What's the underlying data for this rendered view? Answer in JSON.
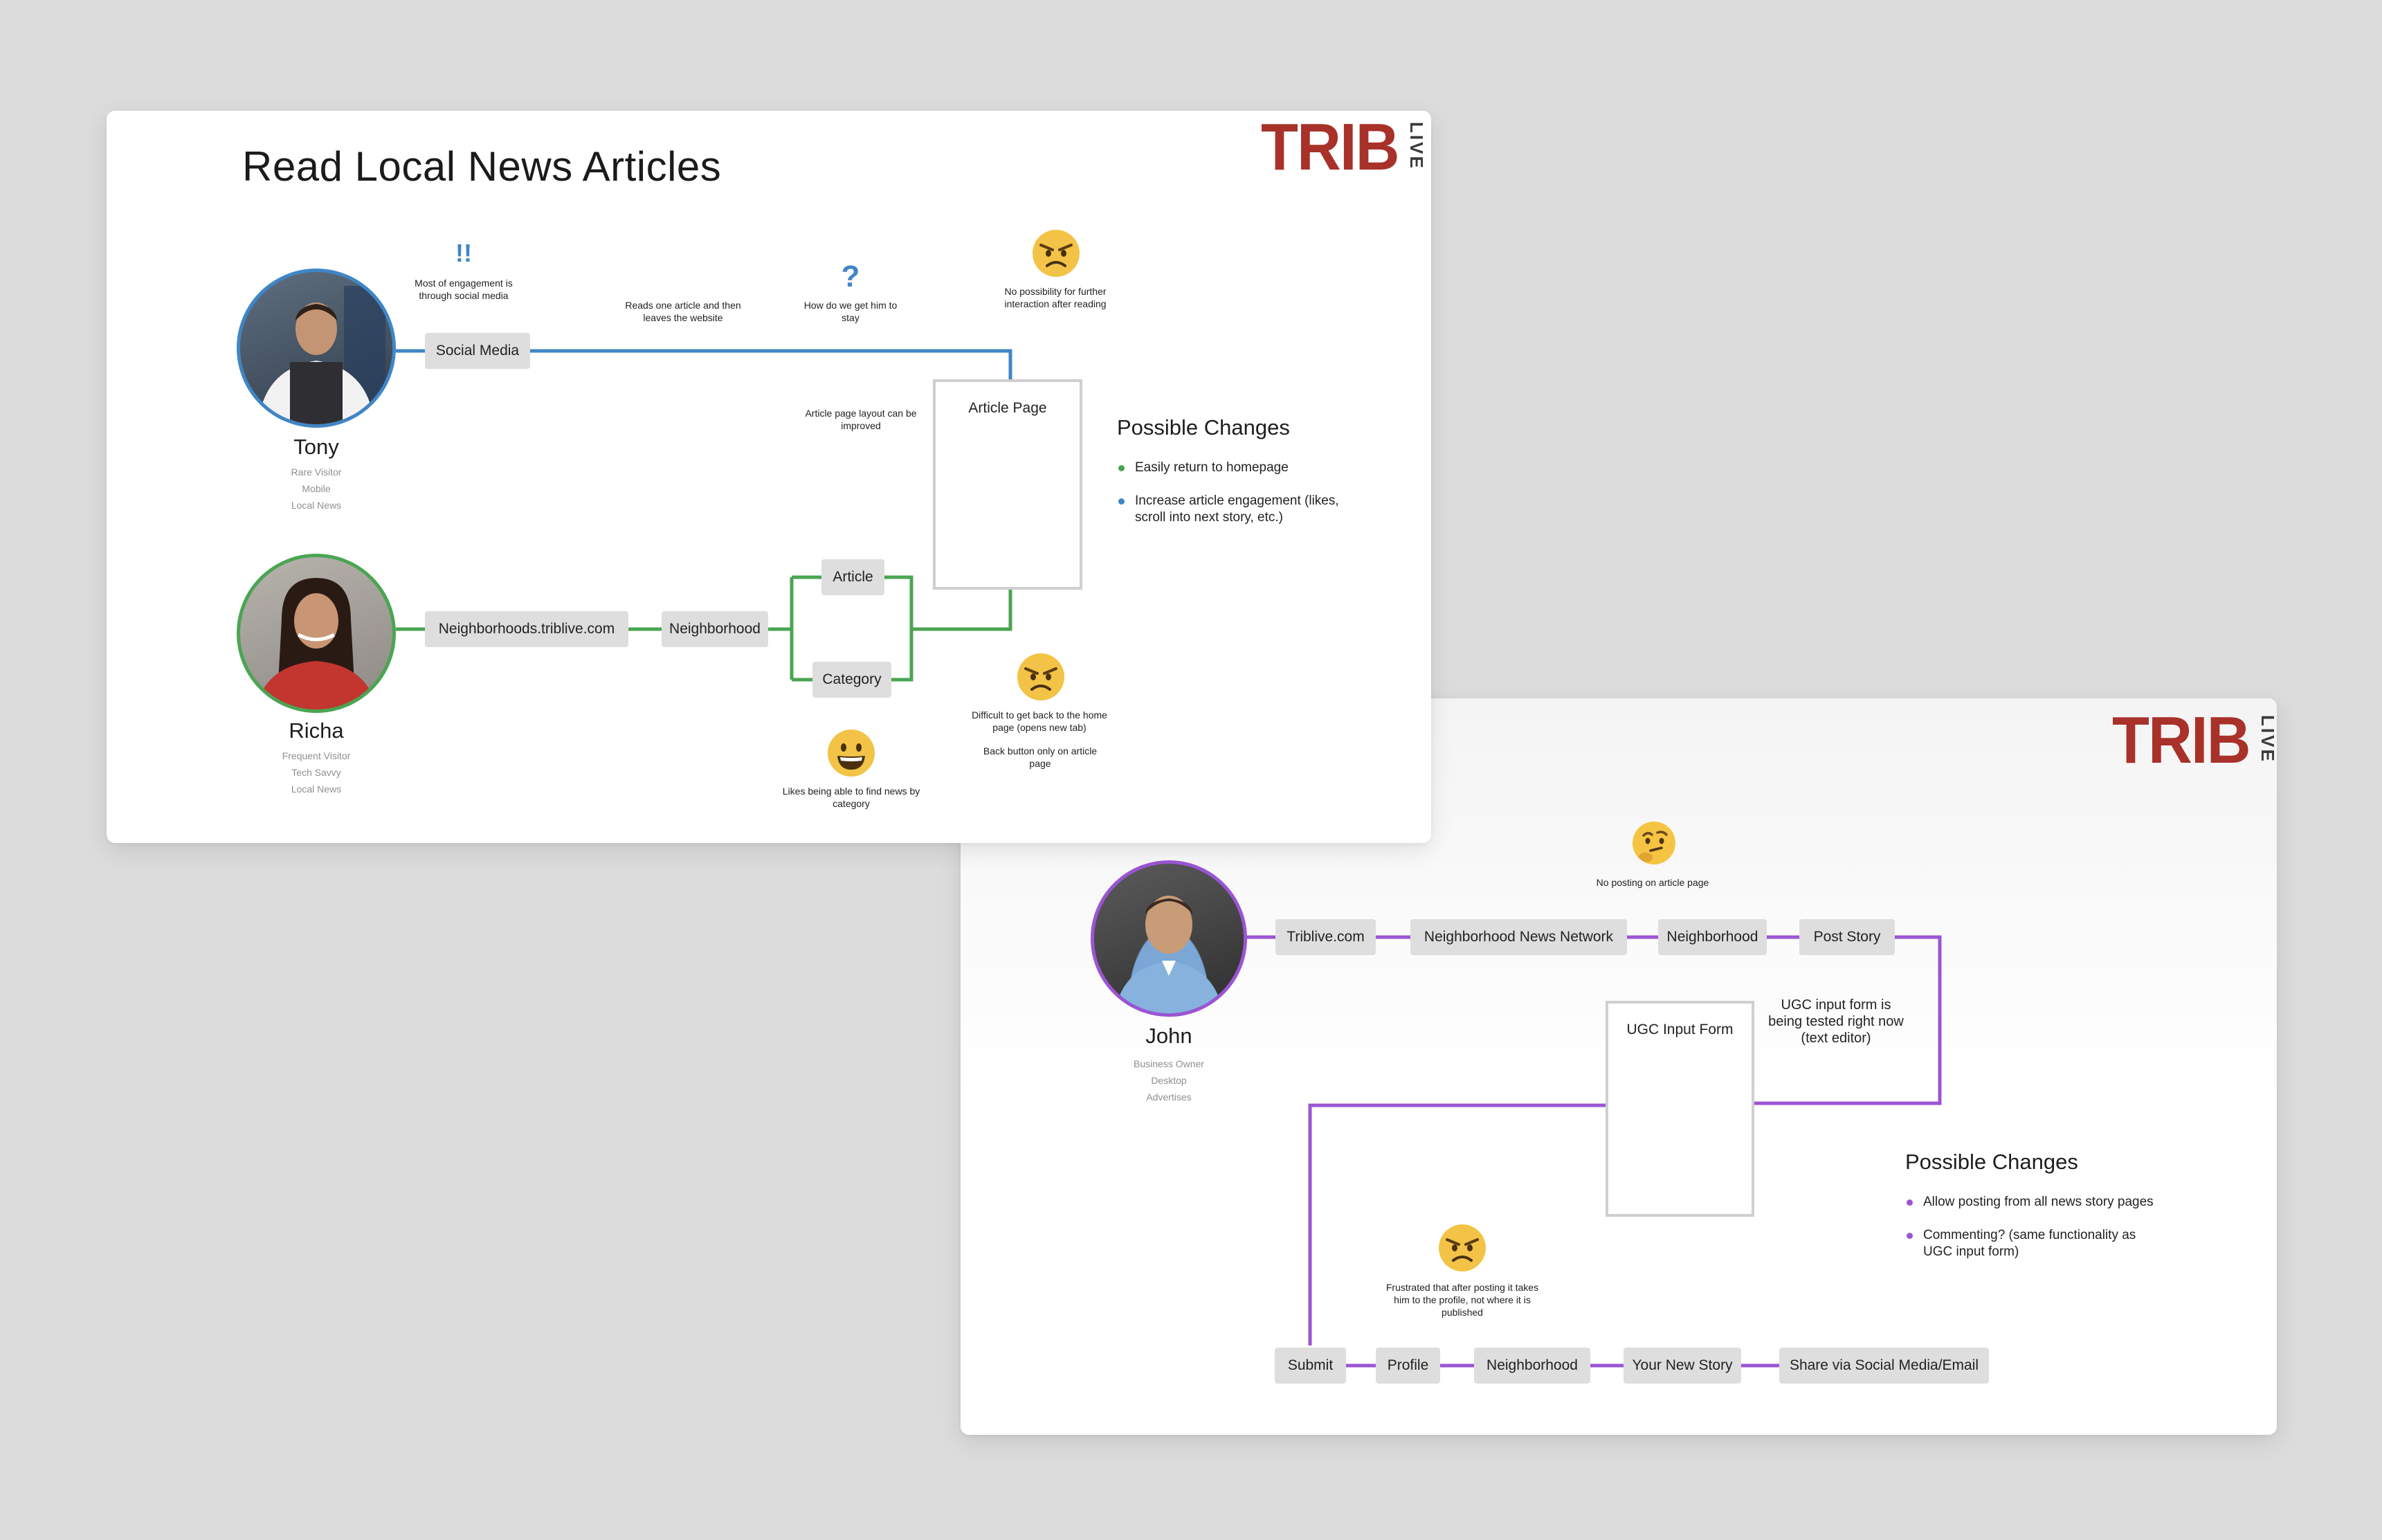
{
  "slide1": {
    "title": "Read Local News Articles",
    "logo": {
      "main": "TRIB",
      "sub": "LIVE"
    },
    "personas": [
      {
        "name": "Tony",
        "meta": [
          "Rare Visitor",
          "Mobile",
          "Local News"
        ],
        "ring_color": "#3f86c6"
      },
      {
        "name": "Richa",
        "meta": [
          "Frequent Visitor",
          "Tech Savvy",
          "Local News"
        ],
        "ring_color": "#4aa552"
      }
    ],
    "steps": {
      "social_media": "Social Media",
      "neighborhoods_site": "Neighborhoods.triblive.com",
      "neighborhood": "Neighborhood",
      "article": "Article",
      "category": "Category",
      "article_page": "Article Page"
    },
    "notes": {
      "engagement_marks": "!!",
      "engagement": "Most of engagement is through social media",
      "reads_one": "Reads one article and then leaves the website",
      "question_mark": "?",
      "how_stay": "How do we get him to stay",
      "no_possibility": "No possibility for further interaction after reading",
      "layout_improved": "Article page layout can be improved",
      "difficult_back": "Difficult to get back to the home page (opens new tab)",
      "back_button": "Back button only on article page",
      "likes_category": "Likes being able to find news by category"
    },
    "possible_changes": {
      "heading": "Possible Changes",
      "items": [
        "Easily return to homepage",
        "Increase article engagement (likes, scroll into next story, etc.)"
      ]
    },
    "colors": {
      "tony_line": "#3f86c6",
      "richa_line": "#4aa552"
    }
  },
  "slide2": {
    "logo": {
      "main": "TRIB",
      "sub": "LIVE"
    },
    "persona": {
      "name": "John",
      "meta": [
        "Business Owner",
        "Desktop",
        "Advertises"
      ],
      "ring_color": "#9b55d3"
    },
    "steps": {
      "triblive": "Triblive.com",
      "nnn": "Neighborhood News Network",
      "neighborhood": "Neighborhood",
      "post_story": "Post Story",
      "ugc_form": "UGC Input Form",
      "submit": "Submit",
      "profile": "Profile",
      "neighborhood2": "Neighborhood",
      "your_new_story": "Your New Story",
      "share": "Share via Social Media/Email"
    },
    "notes": {
      "no_posting": "No posting on article page",
      "ugc_tested": "UGC input form is being tested right now (text editor)",
      "frustrated": "Frustrated that after posting it takes him to the profile, not where it is published"
    },
    "possible_changes": {
      "heading": "Possible Changes",
      "items": [
        "Allow posting from all news story pages",
        "Commenting? (same functionality as UGC input form)"
      ]
    },
    "colors": {
      "john_line": "#9b55d3"
    }
  },
  "icons": {
    "angry": "angry-face-icon",
    "happy": "grinning-face-icon",
    "thinking": "thinking-face-icon"
  }
}
